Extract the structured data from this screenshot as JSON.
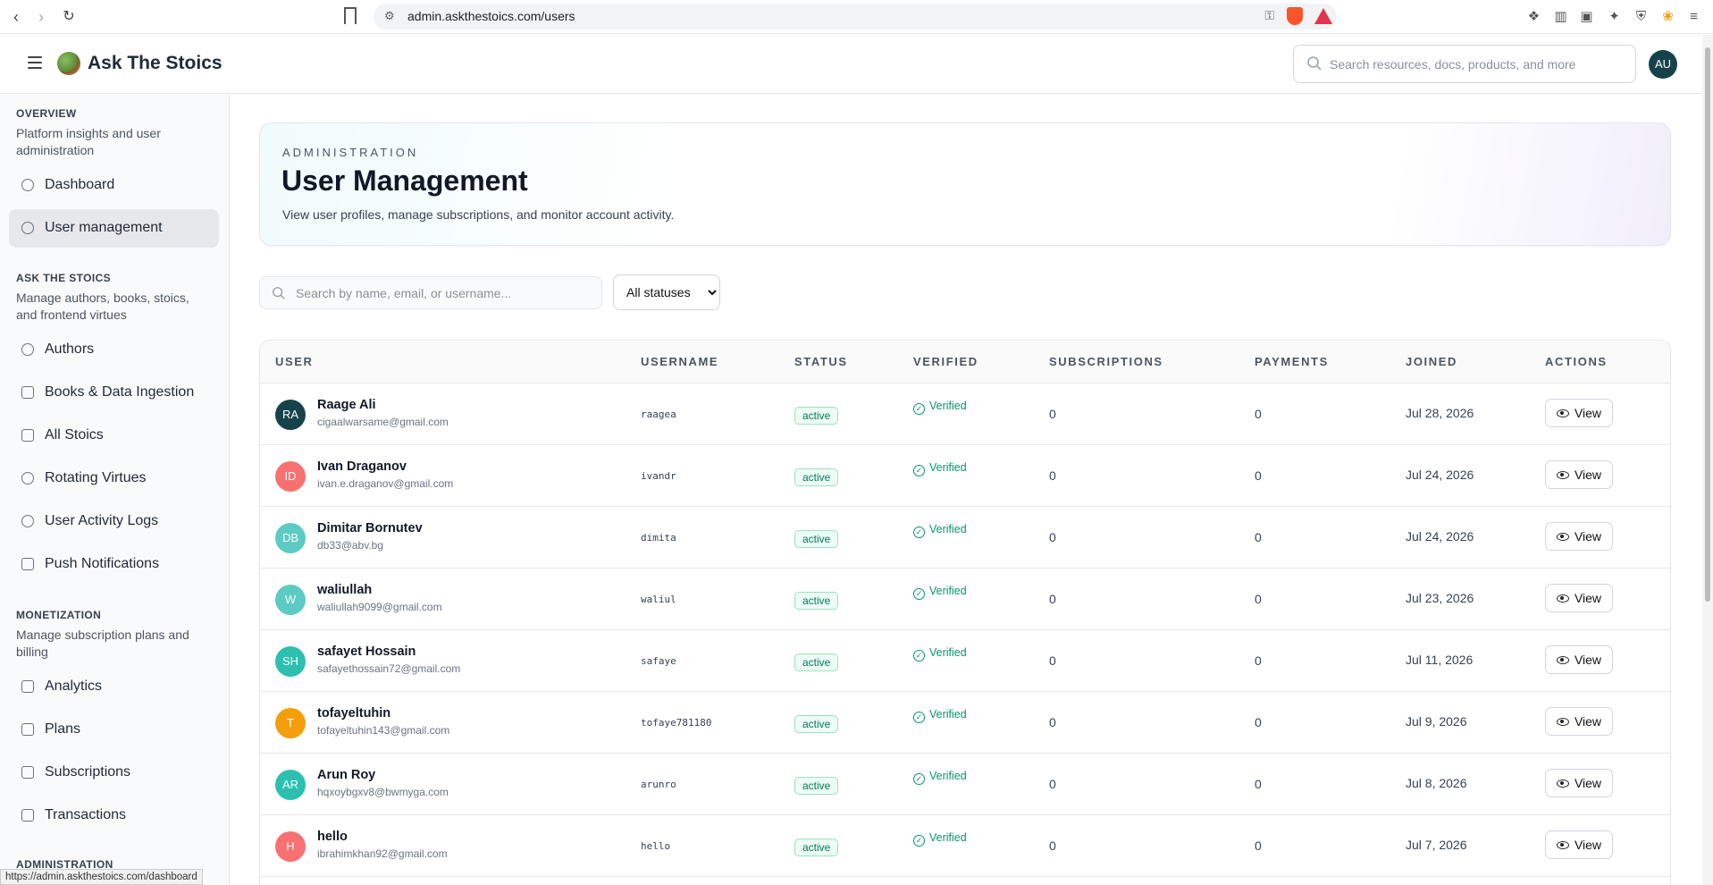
{
  "browser": {
    "url": "admin.askthestoics.com/users",
    "status_url": "https://admin.askthestoics.com/dashboard"
  },
  "header": {
    "brand": "Ask The Stoics",
    "search_placeholder": "Search resources, docs, products, and more",
    "avatar_initials": "AU"
  },
  "sidebar": {
    "overview_title": "OVERVIEW",
    "overview_desc": "Platform insights and user administration",
    "dashboard": "Dashboard",
    "user_management": "User management",
    "stoics_title": "ASK THE STOICS",
    "stoics_desc": "Manage authors, books, stoics, and frontend virtues",
    "authors": "Authors",
    "books": "Books & Data Ingestion",
    "all_stoics": "All Stoics",
    "virtues": "Rotating Virtues",
    "logs": "User Activity Logs",
    "push": "Push Notifications",
    "monetization_title": "MONETIZATION",
    "monetization_desc": "Manage subscription plans and billing",
    "analytics": "Analytics",
    "plans": "Plans",
    "subscriptions": "Subscriptions",
    "transactions": "Transactions",
    "administration_title": "ADMINISTRATION"
  },
  "hero": {
    "eyebrow": "ADMINISTRATION",
    "title": "User Management",
    "subtitle": "View user profiles, manage subscriptions, and monitor account activity."
  },
  "filters": {
    "search_placeholder": "Search by name, email, or username...",
    "status_selected": "All statuses"
  },
  "table": {
    "columns": [
      "USER",
      "USERNAME",
      "STATUS",
      "VERIFIED",
      "SUBSCRIPTIONS",
      "PAYMENTS",
      "JOINED",
      "ACTIONS"
    ],
    "view_label": "View",
    "rows": [
      {
        "initials": "RA",
        "color": "#16434b",
        "name": "Raage Ali",
        "email": "cigaalwarsame@gmail.com",
        "username": "raagea",
        "status": "active",
        "verified": "Verified",
        "subscriptions": "0",
        "payments": "0",
        "joined": "Jul 28, 2026"
      },
      {
        "initials": "ID",
        "color": "#f87171",
        "name": "Ivan Draganov",
        "email": "ivan.e.draganov@gmail.com",
        "username": "ivandr",
        "status": "active",
        "verified": "Verified",
        "subscriptions": "0",
        "payments": "0",
        "joined": "Jul 24, 2026"
      },
      {
        "initials": "DB",
        "color": "#5ccbc3",
        "name": "Dimitar Bornutev",
        "email": "db33@abv.bg",
        "username": "dimita",
        "status": "active",
        "verified": "Verified",
        "subscriptions": "0",
        "payments": "0",
        "joined": "Jul 24, 2026"
      },
      {
        "initials": "W",
        "color": "#5ccbc3",
        "name": "waliullah",
        "email": "waliullah9099@gmail.com",
        "username": "waliul",
        "status": "active",
        "verified": "Verified",
        "subscriptions": "0",
        "payments": "0",
        "joined": "Jul 23, 2026"
      },
      {
        "initials": "SH",
        "color": "#2dbfb0",
        "name": "safayet Hossain",
        "email": "safayethossain72@gmail.com",
        "username": "safaye",
        "status": "active",
        "verified": "Verified",
        "subscriptions": "0",
        "payments": "0",
        "joined": "Jul 11, 2026"
      },
      {
        "initials": "T",
        "color": "#f59e0b",
        "name": "tofayeltuhin",
        "email": "tofayeltuhin143@gmail.com",
        "username": "tofaye781180",
        "status": "active",
        "verified": "Verified",
        "subscriptions": "0",
        "payments": "0",
        "joined": "Jul 9, 2026"
      },
      {
        "initials": "AR",
        "color": "#2dbfb0",
        "name": "Arun Roy",
        "email": "hqxoybgxv8@bwmyga.com",
        "username": "arunro",
        "status": "active",
        "verified": "Verified",
        "subscriptions": "0",
        "payments": "0",
        "joined": "Jul 8, 2026"
      },
      {
        "initials": "H",
        "color": "#f87171",
        "name": "hello",
        "email": "ibrahimkhan92@gmail.com",
        "username": "hello",
        "status": "active",
        "verified": "Verified",
        "subscriptions": "0",
        "payments": "0",
        "joined": "Jul 7, 2026"
      }
    ]
  }
}
